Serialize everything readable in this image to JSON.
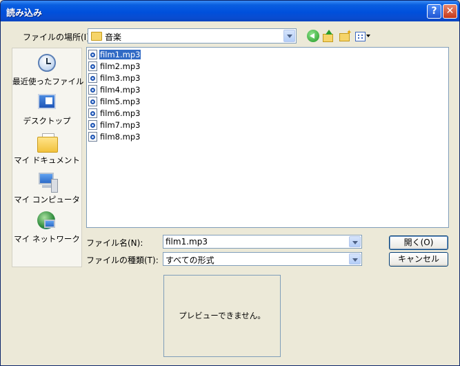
{
  "window": {
    "title": "読み込み",
    "help_glyph": "?",
    "close_glyph": "✕"
  },
  "lookin": {
    "label": "ファイルの場所(I):",
    "value": "音楽"
  },
  "places": [
    {
      "label": "最近使ったファイル",
      "icon": "recent-documents-icon"
    },
    {
      "label": "デスクトップ",
      "icon": "desktop-icon"
    },
    {
      "label": "マイ ドキュメント",
      "icon": "my-documents-icon"
    },
    {
      "label": "マイ コンピュータ",
      "icon": "my-computer-icon"
    },
    {
      "label": "マイ ネットワーク",
      "icon": "my-network-icon"
    }
  ],
  "files": [
    {
      "name": "film1.mp3",
      "selected": true
    },
    {
      "name": "film2.mp3",
      "selected": false
    },
    {
      "name": "film3.mp3",
      "selected": false
    },
    {
      "name": "film4.mp3",
      "selected": false
    },
    {
      "name": "film5.mp3",
      "selected": false
    },
    {
      "name": "film6.mp3",
      "selected": false
    },
    {
      "name": "film7.mp3",
      "selected": false
    },
    {
      "name": "film8.mp3",
      "selected": false
    }
  ],
  "filename": {
    "label": "ファイル名(N):",
    "value": "film1.mp3"
  },
  "filetype": {
    "label": "ファイルの種類(T):",
    "value": "すべての形式"
  },
  "buttons": {
    "open": "開く(O)",
    "cancel": "キャンセル"
  },
  "preview": {
    "text": "プレビューできません。"
  },
  "colors": {
    "selection": "#316ac5",
    "titlebar": "#0050dc",
    "dialog_bg": "#ece9d8"
  }
}
